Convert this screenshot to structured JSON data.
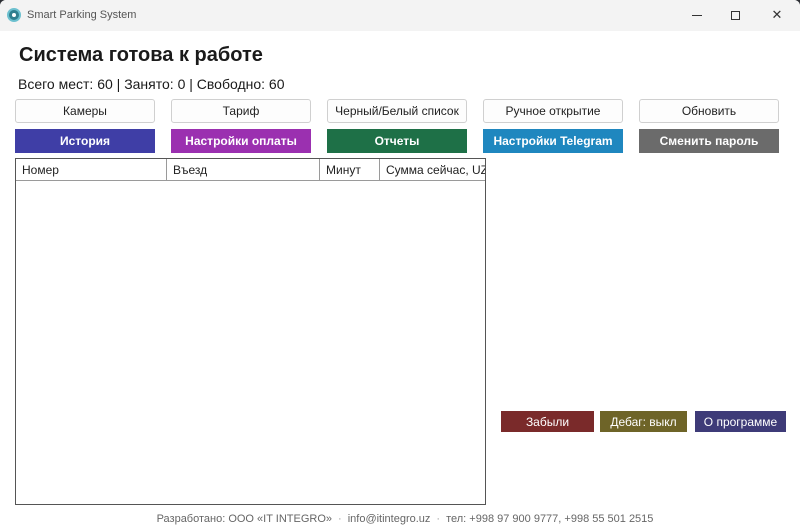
{
  "window": {
    "title": "Smart Parking System",
    "minimize_glyph": "",
    "maximize_glyph": "",
    "close_glyph": "✕"
  },
  "header": {
    "status": "Система готова к работе",
    "counts": "Всего мест: 60 | Занято: 0 | Свободно: 60"
  },
  "toolbar_row1": [
    {
      "label": "Камеры"
    },
    {
      "label": "Тариф"
    },
    {
      "label": "Черный/Белый список"
    },
    {
      "label": "Ручное открытие"
    },
    {
      "label": "Обновить"
    }
  ],
  "toolbar_row2": [
    {
      "label": "История",
      "color": "#3f3ea6"
    },
    {
      "label": "Настройки оплаты",
      "color": "#9b30b0"
    },
    {
      "label": "Отчеты",
      "color": "#1e7047"
    },
    {
      "label": "Настройки Telegram",
      "color": "#1f87bf"
    },
    {
      "label": "Сменить пароль",
      "color": "#6b6b6b"
    }
  ],
  "table": {
    "columns": [
      "Номер",
      "Въезд",
      "Минут",
      "Сумма сейчас, UZS"
    ],
    "rows": []
  },
  "side_buttons": [
    {
      "label": "Забыли",
      "color": "#7a2a2a"
    },
    {
      "label": "Дебаг: выкл",
      "color": "#6e6428"
    },
    {
      "label": "О программе",
      "color": "#3e3b78"
    }
  ],
  "footer": {
    "developer": "Разработано: ООО «IT INTEGRO»",
    "email": "info@itintegro.uz",
    "phone": "тел: +998 97 900 9777, +998 55 501 2515",
    "separator": "·"
  }
}
